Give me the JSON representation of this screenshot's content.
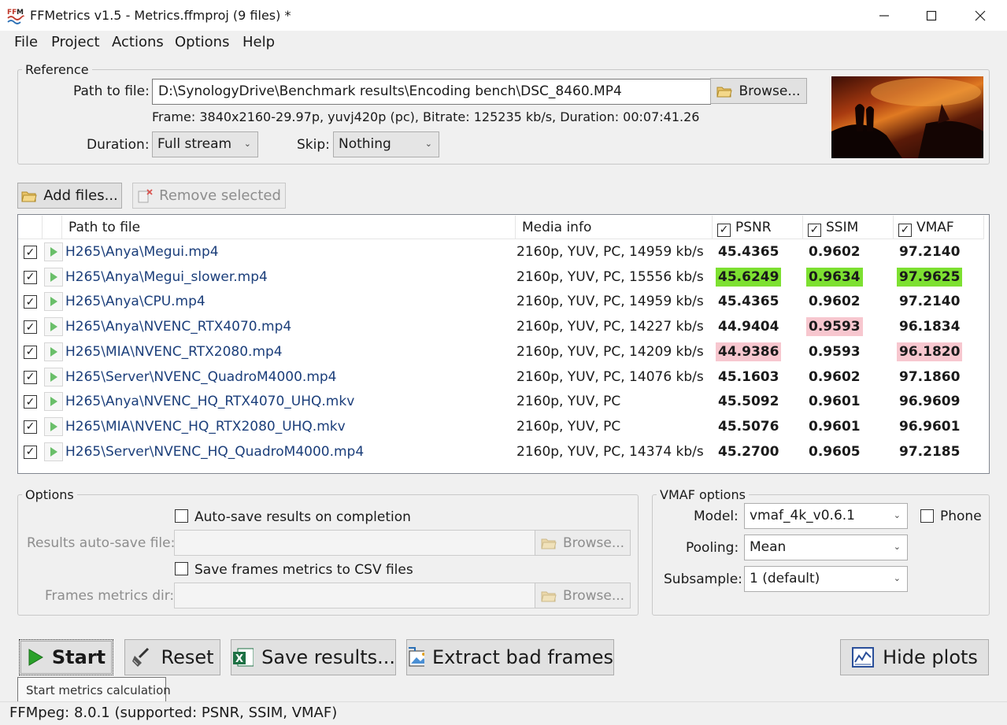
{
  "window": {
    "title": "FFMetrics v1.5 - Metrics.ffmproj (9 files) *"
  },
  "menu": [
    "File",
    "Project",
    "Actions",
    "Options",
    "Help"
  ],
  "reference": {
    "group_title": "Reference",
    "path_label": "Path to file:",
    "path_value": "D:\\SynologyDrive\\Benchmark results\\Encoding bench\\DSC_8460.MP4",
    "browse_label": "Browse...",
    "frame_info": "Frame: 3840x2160-29.97p, yuvj420p (pc), Bitrate: 125235 kb/s, Duration: 00:07:41.26",
    "duration_label": "Duration:",
    "duration_value": "Full stream",
    "skip_label": "Skip:",
    "skip_value": "Nothing"
  },
  "toolbar": {
    "add_files": "Add files...",
    "remove_selected": "Remove selected"
  },
  "table": {
    "headers": {
      "path": "Path to file",
      "media": "Media info",
      "psnr": "PSNR",
      "ssim": "SSIM",
      "vmaf": "VMAF"
    },
    "rows": [
      {
        "path": "H265\\Anya\\Megui.mp4",
        "media": "2160p, YUV, PC, 14959 kb/s",
        "psnr": "45.4365",
        "ssim": "0.9602",
        "vmaf": "97.2140",
        "psnr_hl": "",
        "ssim_hl": "",
        "vmaf_hl": ""
      },
      {
        "path": "H265\\Anya\\Megui_slower.mp4",
        "media": "2160p, YUV, PC, 15556 kb/s",
        "psnr": "45.6249",
        "ssim": "0.9634",
        "vmaf": "97.9625",
        "psnr_hl": "best",
        "ssim_hl": "best",
        "vmaf_hl": "best"
      },
      {
        "path": "H265\\Anya\\CPU.mp4",
        "media": "2160p, YUV, PC, 14959 kb/s",
        "psnr": "45.4365",
        "ssim": "0.9602",
        "vmaf": "97.2140",
        "psnr_hl": "",
        "ssim_hl": "",
        "vmaf_hl": ""
      },
      {
        "path": "H265\\Anya\\NVENC_RTX4070.mp4",
        "media": "2160p, YUV, PC, 14227 kb/s",
        "psnr": "44.9404",
        "ssim": "0.9593",
        "vmaf": "96.1834",
        "psnr_hl": "",
        "ssim_hl": "worst",
        "vmaf_hl": ""
      },
      {
        "path": "H265\\MIA\\NVENC_RTX2080.mp4",
        "media": "2160p, YUV, PC, 14209 kb/s",
        "psnr": "44.9386",
        "ssim": "0.9593",
        "vmaf": "96.1820",
        "psnr_hl": "worst",
        "ssim_hl": "",
        "vmaf_hl": "worst"
      },
      {
        "path": "H265\\Server\\NVENC_QuadroM4000.mp4",
        "media": "2160p, YUV, PC, 14076 kb/s",
        "psnr": "45.1603",
        "ssim": "0.9602",
        "vmaf": "97.1860",
        "psnr_hl": "",
        "ssim_hl": "",
        "vmaf_hl": ""
      },
      {
        "path": "H265\\Anya\\NVENC_HQ_RTX4070_UHQ.mkv",
        "media": "2160p, YUV, PC",
        "psnr": "45.5092",
        "ssim": "0.9601",
        "vmaf": "96.9609",
        "psnr_hl": "",
        "ssim_hl": "",
        "vmaf_hl": ""
      },
      {
        "path": "H265\\MIA\\NVENC_HQ_RTX2080_UHQ.mkv",
        "media": "2160p, YUV, PC",
        "psnr": "45.5076",
        "ssim": "0.9601",
        "vmaf": "96.9601",
        "psnr_hl": "",
        "ssim_hl": "",
        "vmaf_hl": ""
      },
      {
        "path": "H265\\Server\\NVENC_HQ_QuadroM4000.mp4",
        "media": "2160p, YUV, PC, 14374 kb/s",
        "psnr": "45.2700",
        "ssim": "0.9605",
        "vmaf": "97.2185",
        "psnr_hl": "",
        "ssim_hl": "",
        "vmaf_hl": ""
      }
    ]
  },
  "options": {
    "group_title": "Options",
    "autosave_label": "Auto-save results on completion",
    "results_file_label": "Results auto-save file:",
    "browse_label": "Browse...",
    "csv_label": "Save frames metrics to CSV files",
    "frames_dir_label": "Frames metrics dir:"
  },
  "vmaf": {
    "group_title": "VMAF options",
    "model_label": "Model:",
    "model_value": "vmaf_4k_v0.6.1",
    "phone_label": "Phone",
    "pooling_label": "Pooling:",
    "pooling_value": "Mean",
    "subsample_label": "Subsample:",
    "subsample_value": "1 (default)"
  },
  "actions": {
    "start": "Start",
    "reset": "Reset",
    "save": "Save results...",
    "extract": "Extract bad frames",
    "hide_plots": "Hide plots"
  },
  "tooltip": "Start metrics calculation",
  "status": "FFMpeg: 8.0.1 (supported: PSNR, SSIM, VMAF)",
  "colors": {
    "best": "#7de031",
    "worst": "#f7c7cf",
    "path_text": "#1b3e7a"
  }
}
